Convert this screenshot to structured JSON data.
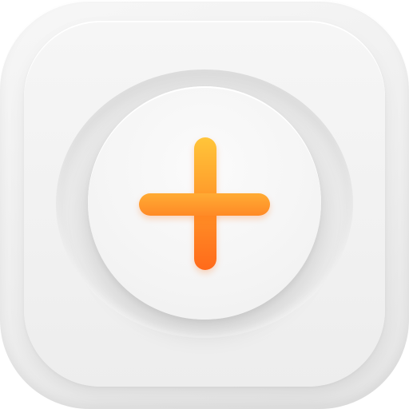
{
  "app_icon": {
    "icon_name": "plus-icon",
    "colors": {
      "tile_light": "#f7f7f7",
      "tile_dark": "#e4e4e4",
      "accent_top": "#ffc53a",
      "accent_mid": "#ff9a2a",
      "accent_bottom": "#ff6a1a"
    }
  }
}
